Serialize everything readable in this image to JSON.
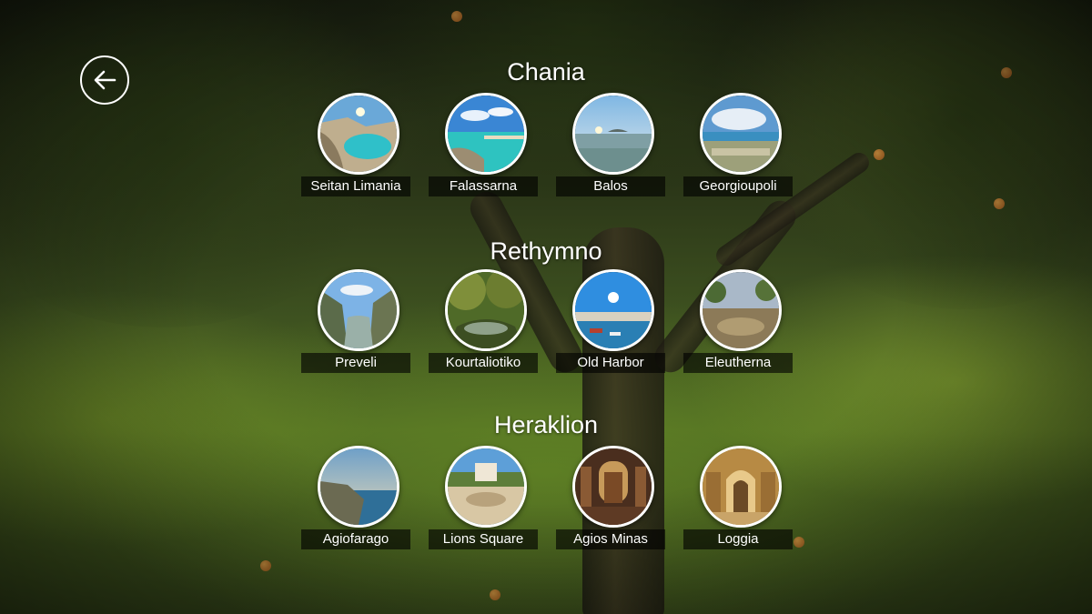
{
  "regions": [
    {
      "title": "Chania",
      "places": [
        {
          "label": "Seitan Limania",
          "icon": "cove-beach-photo"
        },
        {
          "label": "Falassarna",
          "icon": "turquoise-beach-photo"
        },
        {
          "label": "Balos",
          "icon": "lagoon-sunset-photo"
        },
        {
          "label": "Georgioupoli",
          "icon": "coastal-town-photo"
        }
      ]
    },
    {
      "title": "Rethymno",
      "places": [
        {
          "label": "Preveli",
          "icon": "river-gorge-photo"
        },
        {
          "label": "Kourtaliotiko",
          "icon": "forest-stream-photo"
        },
        {
          "label": "Old Harbor",
          "icon": "harbor-boats-photo"
        },
        {
          "label": "Eleutherna",
          "icon": "ruins-site-photo"
        }
      ]
    },
    {
      "title": "Heraklion",
      "places": [
        {
          "label": "Agiofarago",
          "icon": "cliff-sea-photo"
        },
        {
          "label": "Lions Square",
          "icon": "fountain-square-photo"
        },
        {
          "label": "Agios Minas",
          "icon": "church-interior-photo"
        },
        {
          "label": "Loggia",
          "icon": "arched-hall-photo"
        }
      ]
    }
  ],
  "back_button": {
    "icon": "back-arrow-icon"
  },
  "colors": {
    "ring": "#ffffff",
    "label_bg": "rgba(0,0,0,0.62)",
    "text": "#ffffff"
  }
}
